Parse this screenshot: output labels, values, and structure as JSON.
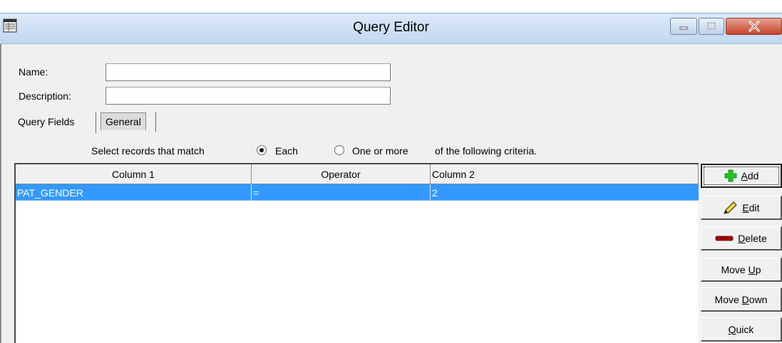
{
  "window": {
    "title": "Query Editor"
  },
  "form": {
    "name_label": "Name:",
    "name_value": "",
    "description_label": "Description:",
    "description_value": ""
  },
  "tabs": [
    {
      "label": "Query Fields",
      "active": true
    },
    {
      "label": "General",
      "active": false
    }
  ],
  "criteria": {
    "prefix": "Select records that match",
    "option_each": "Each",
    "option_one_or_more": "One or more",
    "suffix": "of the following criteria.",
    "selected": "Each"
  },
  "grid": {
    "columns": [
      "Column 1",
      "Operator",
      "Column 2"
    ],
    "rows": [
      {
        "column1": "PAT_GENDER",
        "operator": "=",
        "column2": "2",
        "selected": true
      }
    ]
  },
  "buttons": {
    "add": {
      "pre": "",
      "key": "A",
      "post": "dd"
    },
    "edit": {
      "pre": "",
      "key": "E",
      "post": "dit"
    },
    "delete": {
      "pre": "",
      "key": "D",
      "post": "elete"
    },
    "move_up": {
      "pre": "Move ",
      "key": "U",
      "post": "p"
    },
    "move_down": {
      "pre": "Move ",
      "key": "D",
      "post": "own"
    },
    "quick": {
      "pre": "",
      "key": "Q",
      "post": "uick"
    }
  },
  "colors": {
    "selection": "#3399ff",
    "close_button": "#c4452c"
  },
  "icons": {
    "add": "green-plus-icon",
    "edit": "pencil-icon",
    "delete": "red-minus-icon"
  }
}
